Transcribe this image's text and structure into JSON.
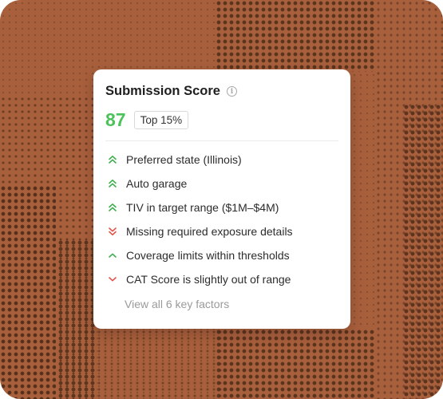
{
  "card": {
    "title": "Submission Score",
    "info_icon": "info-icon",
    "score": "87",
    "badge": "Top 15%",
    "score_color": "#4cc35a"
  },
  "factors": [
    {
      "label": "Preferred state (Illinois)",
      "icon": "double-chevron-up-icon",
      "tone": "positive"
    },
    {
      "label": "Auto garage",
      "icon": "double-chevron-up-icon",
      "tone": "positive"
    },
    {
      "label": "TIV in target range ($1M–$4M)",
      "icon": "double-chevron-up-icon",
      "tone": "positive"
    },
    {
      "label": "Missing required exposure details",
      "icon": "double-chevron-down-icon",
      "tone": "negative"
    },
    {
      "label": "Coverage limits within thresholds",
      "icon": "chevron-up-icon",
      "tone": "positive"
    },
    {
      "label": "CAT Score is slightly out of range",
      "icon": "chevron-down-icon",
      "tone": "negative"
    }
  ],
  "view_all": "View all 6 key factors",
  "colors": {
    "positive": "#3fae4f",
    "negative": "#e0524a",
    "background": "#a85f3c"
  }
}
